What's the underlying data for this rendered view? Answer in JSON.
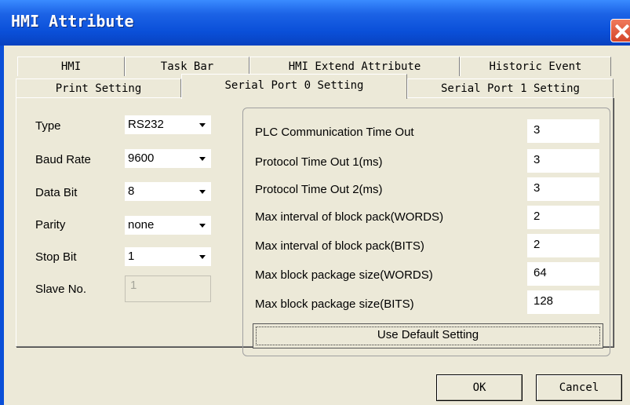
{
  "window": {
    "title": "HMI Attribute",
    "close_icon": "close-icon"
  },
  "tabs_row1": [
    "HMI",
    "Task Bar",
    "HMI Extend Attribute",
    "Historic Event"
  ],
  "tabs_row2": [
    "Print Setting",
    "Serial Port 0 Setting",
    "Serial Port 1 Setting"
  ],
  "selected_tab": "Serial Port 0 Setting",
  "port": {
    "type": {
      "label": "Type",
      "value": "RS232"
    },
    "baud_rate": {
      "label": "Baud Rate",
      "value": "9600"
    },
    "data_bit": {
      "label": "Data Bit",
      "value": "8"
    },
    "parity": {
      "label": "Parity",
      "value": "none"
    },
    "stop_bit": {
      "label": "Stop Bit",
      "value": "1"
    },
    "slave_no": {
      "label": "Slave No.",
      "value": "1"
    }
  },
  "timeouts": {
    "plc_timeout": {
      "label": "PLC Communication Time Out",
      "value": "3"
    },
    "protocol_timeout_1": {
      "label": "Protocol Time Out 1(ms)",
      "value": "3"
    },
    "protocol_timeout_2": {
      "label": "Protocol Time Out 2(ms)",
      "value": "3"
    },
    "max_interval_words": {
      "label": "Max interval of block pack(WORDS)",
      "value": "2"
    },
    "max_interval_bits": {
      "label": "Max interval of block pack(BITS)",
      "value": "2"
    },
    "max_block_words": {
      "label": "Max block package size(WORDS)",
      "value": "64"
    },
    "max_block_bits": {
      "label": "Max block package size(BITS)",
      "value": "128"
    }
  },
  "buttons": {
    "use_default": "Use Default Setting",
    "ok": "OK",
    "cancel": "Cancel"
  },
  "colors": {
    "title_bar": "#0a4fd8",
    "dialog_bg": "#ece9d8",
    "close_button": "#d4452a"
  }
}
